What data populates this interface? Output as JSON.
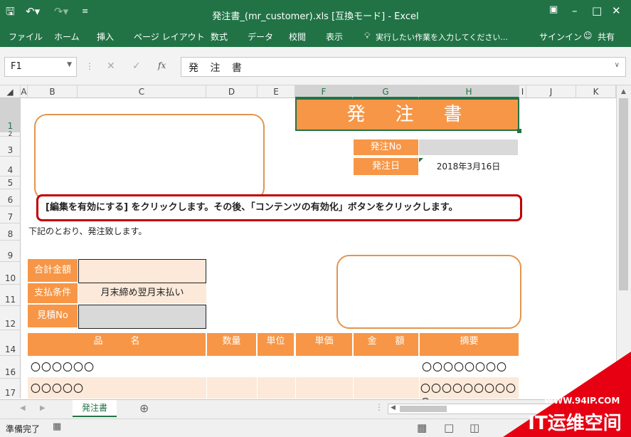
{
  "window": {
    "title": "発注書_(mr_customer).xls [互換モード] - Excel",
    "accent": "#217346"
  },
  "ribbon": {
    "tabs": [
      "ファイル",
      "ホーム",
      "挿入",
      "ページ レイアウト",
      "数式",
      "データ",
      "校閲",
      "表示"
    ],
    "tell_me": "実行したい作業を入力してください...",
    "signin": "サインイン",
    "share": "共有"
  },
  "formula_bar": {
    "name_box": "F1",
    "fx_label": "fx",
    "content": "発 注 書"
  },
  "columns": [
    "A",
    "B",
    "C",
    "D",
    "E",
    "F",
    "G",
    "H",
    "I",
    "J",
    "K"
  ],
  "rows": [
    "1",
    "2",
    "3",
    "4",
    "5",
    "6",
    "7",
    "8",
    "9",
    "10",
    "11",
    "12",
    "14",
    "16",
    "17"
  ],
  "sheet": {
    "title": "発　注　書",
    "order_no_label": "発注No",
    "order_no_value": "",
    "order_date_label": "発注日",
    "order_date_value": "2018年3月16日",
    "intro": "下記のとおり、発注致します。",
    "total_label": "合計金額",
    "total_value": "",
    "payment_label": "支払条件",
    "payment_value": "月末締め翌月末払い",
    "estimate_label": "見積No",
    "estimate_value": "",
    "table_headers": [
      "品　　　名",
      "数量",
      "単位",
      "単価",
      "金　　額",
      "摘要"
    ],
    "table_rows": [
      {
        "name": "〇〇〇〇〇〇",
        "remarks": "〇〇〇〇〇〇〇〇"
      },
      {
        "name": "〇〇〇〇〇",
        "remarks": "〇〇〇〇〇〇〇〇〇〇"
      }
    ]
  },
  "callout": {
    "text": "[編集を有効にする] をクリックします。その後、「コンテンツの有効化」ボタンをクリックします。",
    "border_color": "#c00000"
  },
  "sheet_tabs": {
    "active": "発注書"
  },
  "status": {
    "ready": "準備完了"
  },
  "watermark": {
    "url": "WWW.94IP.COM",
    "brand": "IT运维空间"
  }
}
